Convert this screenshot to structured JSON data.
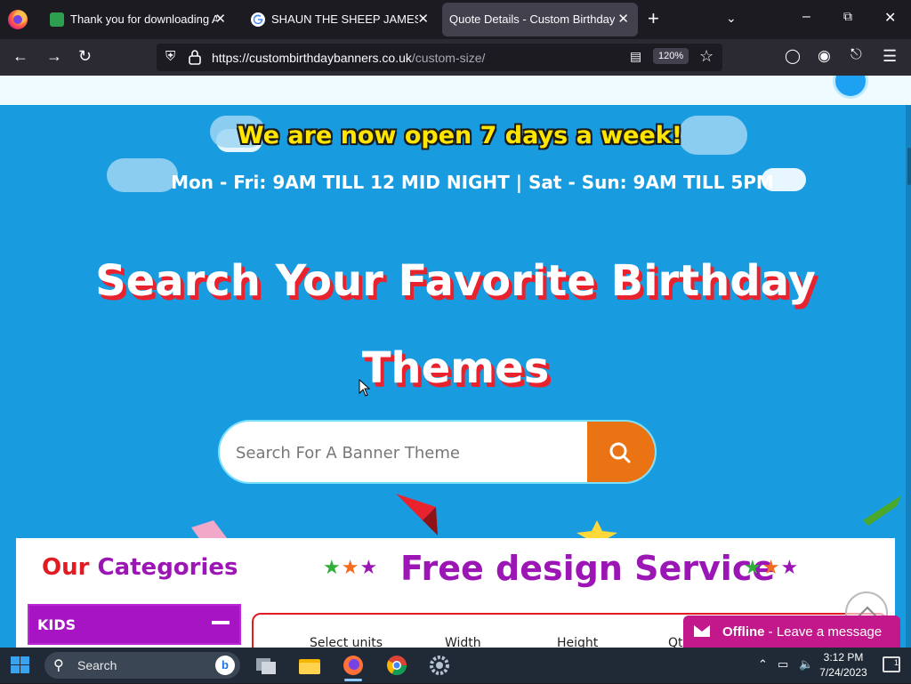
{
  "browser": {
    "tabs": [
      {
        "title": "Thank you for downloading Ad",
        "favicon": "green-y-favicon",
        "color": "#2e9e4f"
      },
      {
        "title": "SHAUN THE SHEEP JAMES BIRH",
        "favicon": "google-favicon",
        "color": "#ffffff"
      },
      {
        "title": "Quote Details - Custom Birthday Ba",
        "favicon": "none",
        "active": true
      }
    ],
    "url_host": "https://custombirthdaybanners.co.uk",
    "url_path": "/custom-size/",
    "zoom": "120%"
  },
  "page": {
    "open_banner": "We are now open 7 days a week!",
    "hours": "Mon - Fri: 9AM TILL 12 MID NIGHT   |   Sat - Sun: 9AM TILL 5PM",
    "hero_line1": "Search Your Favorite Birthday",
    "hero_line2": "Themes",
    "search_placeholder": "Search For A Banner Theme",
    "categories_title_our": "Our",
    "categories_title_rest": "Categories",
    "kids_label": "KIDS",
    "free_design_title": "Free design Service",
    "quote_headers": [
      "Select units",
      "Width",
      "Height",
      "Qt"
    ],
    "chat_status": "Offline",
    "chat_message": " - Leave a message",
    "colors": {
      "page_bg": "#199be0",
      "accent_orange": "#ea7413",
      "purple": "#9b16b5",
      "red": "#e11b22"
    }
  },
  "taskbar": {
    "search_label": "Search",
    "time": "3:12 PM",
    "date": "7/24/2023",
    "notification_count": "1"
  }
}
